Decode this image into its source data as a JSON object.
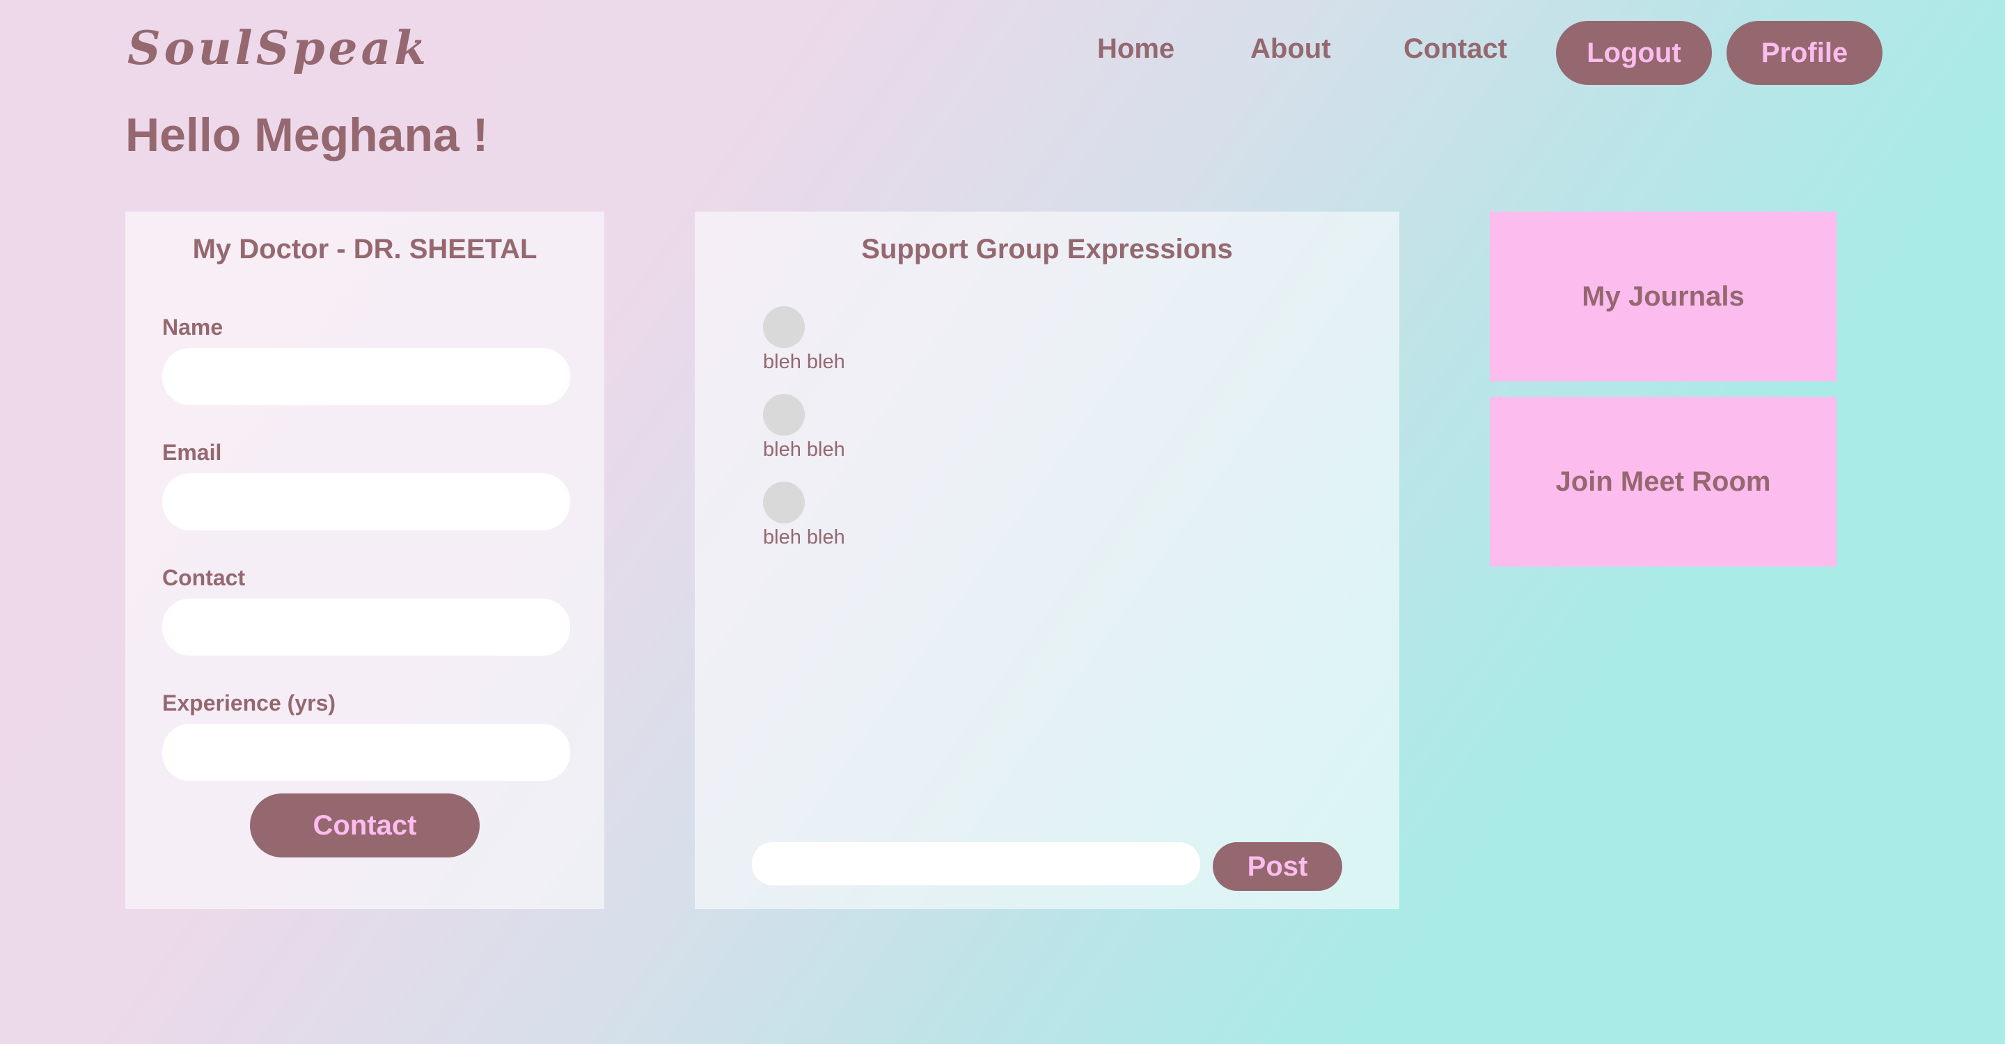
{
  "header": {
    "logo": "SoulSpeak",
    "nav": {
      "home": "Home",
      "about": "About",
      "contact": "Contact"
    },
    "logout_label": "Logout",
    "profile_label": "Profile"
  },
  "greeting": "Hello Meghana !",
  "doctor_form": {
    "title": "My Doctor - DR. SHEETAL",
    "fields": [
      {
        "label": "Name",
        "value": ""
      },
      {
        "label": "Email",
        "value": ""
      },
      {
        "label": "Contact",
        "value": ""
      },
      {
        "label": "Experience (yrs)",
        "value": ""
      }
    ],
    "submit_label": "Contact"
  },
  "support_group": {
    "title": "Support Group Expressions",
    "posts": [
      {
        "text": "bleh bleh"
      },
      {
        "text": "bleh bleh"
      },
      {
        "text": "bleh bleh"
      }
    ],
    "input_value": "",
    "post_label": "Post"
  },
  "tiles": {
    "journals_label": "My Journals",
    "meet_room_label": "Join Meet Room"
  },
  "colors": {
    "accent": "#956870",
    "button_text": "#fcbcee",
    "tile_bg": "#fcbcee"
  }
}
